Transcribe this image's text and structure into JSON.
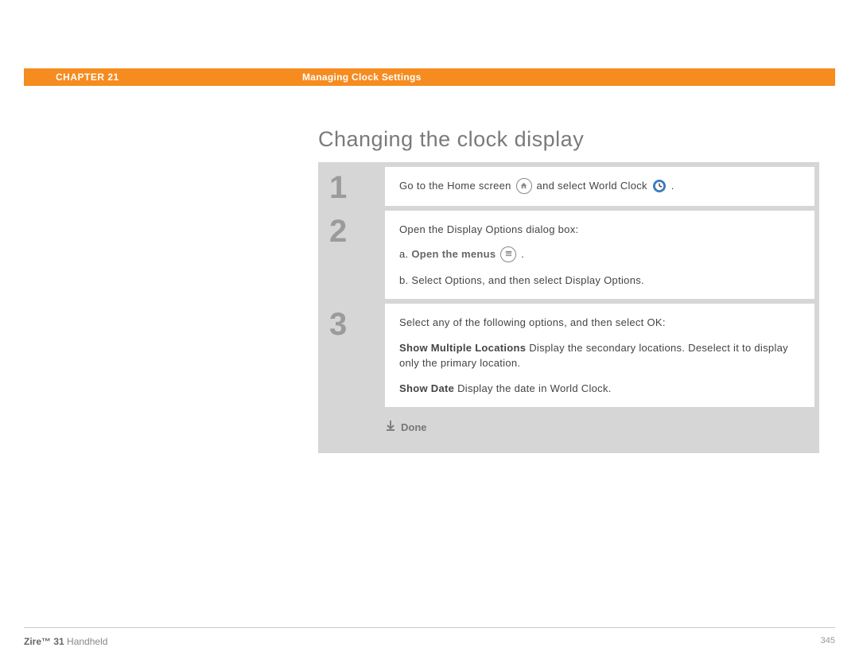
{
  "header": {
    "chapter": "CHAPTER 21",
    "title": "Managing Clock Settings"
  },
  "section_title": "Changing the clock display",
  "steps": [
    {
      "num": "1",
      "line1_a": "Go to the Home screen ",
      "line1_b": " and select World Clock ",
      "line1_c": " ."
    },
    {
      "num": "2",
      "intro": "Open the Display Options dialog box:",
      "a_prefix": "a.  ",
      "a_bold": "Open the menus",
      "a_suffix": " .",
      "b": "b.  Select Options, and then select Display Options."
    },
    {
      "num": "3",
      "intro": "Select any of the following options, and then select OK:",
      "opt1_label": "Show Multiple Locations",
      "opt1_text": "   Display the secondary locations. Deselect it to display only the primary location.",
      "opt2_label": "Show Date",
      "opt2_text": "   Display the date in World Clock."
    }
  ],
  "done": "Done",
  "footer": {
    "product_bold": "Zire™ 31",
    "product_rest": " Handheld",
    "page": "345"
  }
}
